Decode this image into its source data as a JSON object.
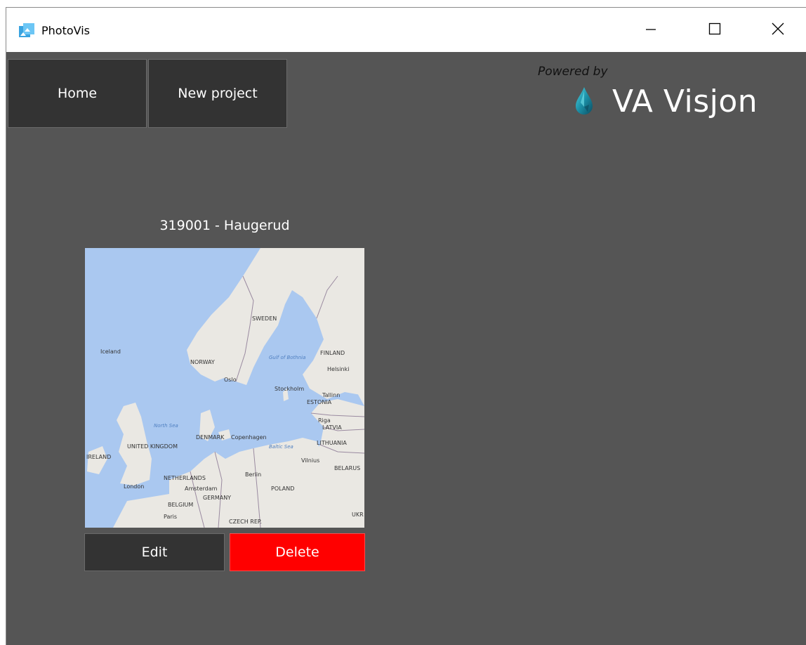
{
  "window": {
    "title": "PhotoVis",
    "app_icon": "photovis-icon",
    "controls": [
      "minimize-icon",
      "maximize-icon",
      "close-icon"
    ]
  },
  "nav": {
    "home_label": "Home",
    "new_project_label": "New project"
  },
  "brand": {
    "powered_by": "Powered by",
    "name": "VA Visjon",
    "icon": "water-drop-icon"
  },
  "project": {
    "title": "319001 - Haugerud",
    "map_labels": {
      "sweden": "SWEDEN",
      "norway": "NORWAY",
      "finland": "FINLAND",
      "oslo": "Oslo",
      "stockholm": "Stockholm",
      "helsinki": "Helsinki",
      "tallinn": "Tallinn",
      "estonia": "ESTONIA",
      "riga": "Riga",
      "latvia": "LATVIA",
      "lithuania": "LITHUANIA",
      "vilnius": "Vilnius",
      "belarus": "BELARUS",
      "denmark": "DENMARK",
      "copenhagen": "Copenhagen",
      "baltic_sea": "Baltic Sea",
      "north_sea": "North Sea",
      "gulf_bothnia": "Gulf of Bothnia",
      "united_kingdom": "UNITED KINGDOM",
      "london": "London",
      "netherlands": "NETHERLANDS",
      "amsterdam": "Amsterdam",
      "germany": "GERMANY",
      "berlin": "Berlin",
      "poland": "POLAND",
      "belgium": "BELGIUM",
      "paris": "Paris",
      "czech": "CZECH REP.",
      "ireland": "IRELAND",
      "iceland": "Iceland",
      "ukraine": "UKR"
    },
    "edit_label": "Edit",
    "delete_label": "Delete",
    "colors": {
      "delete_bg": "#ff0000",
      "button_bg": "#333333",
      "page_bg": "#555555",
      "water": "#aac8f0",
      "land": "#eae8e3"
    }
  }
}
